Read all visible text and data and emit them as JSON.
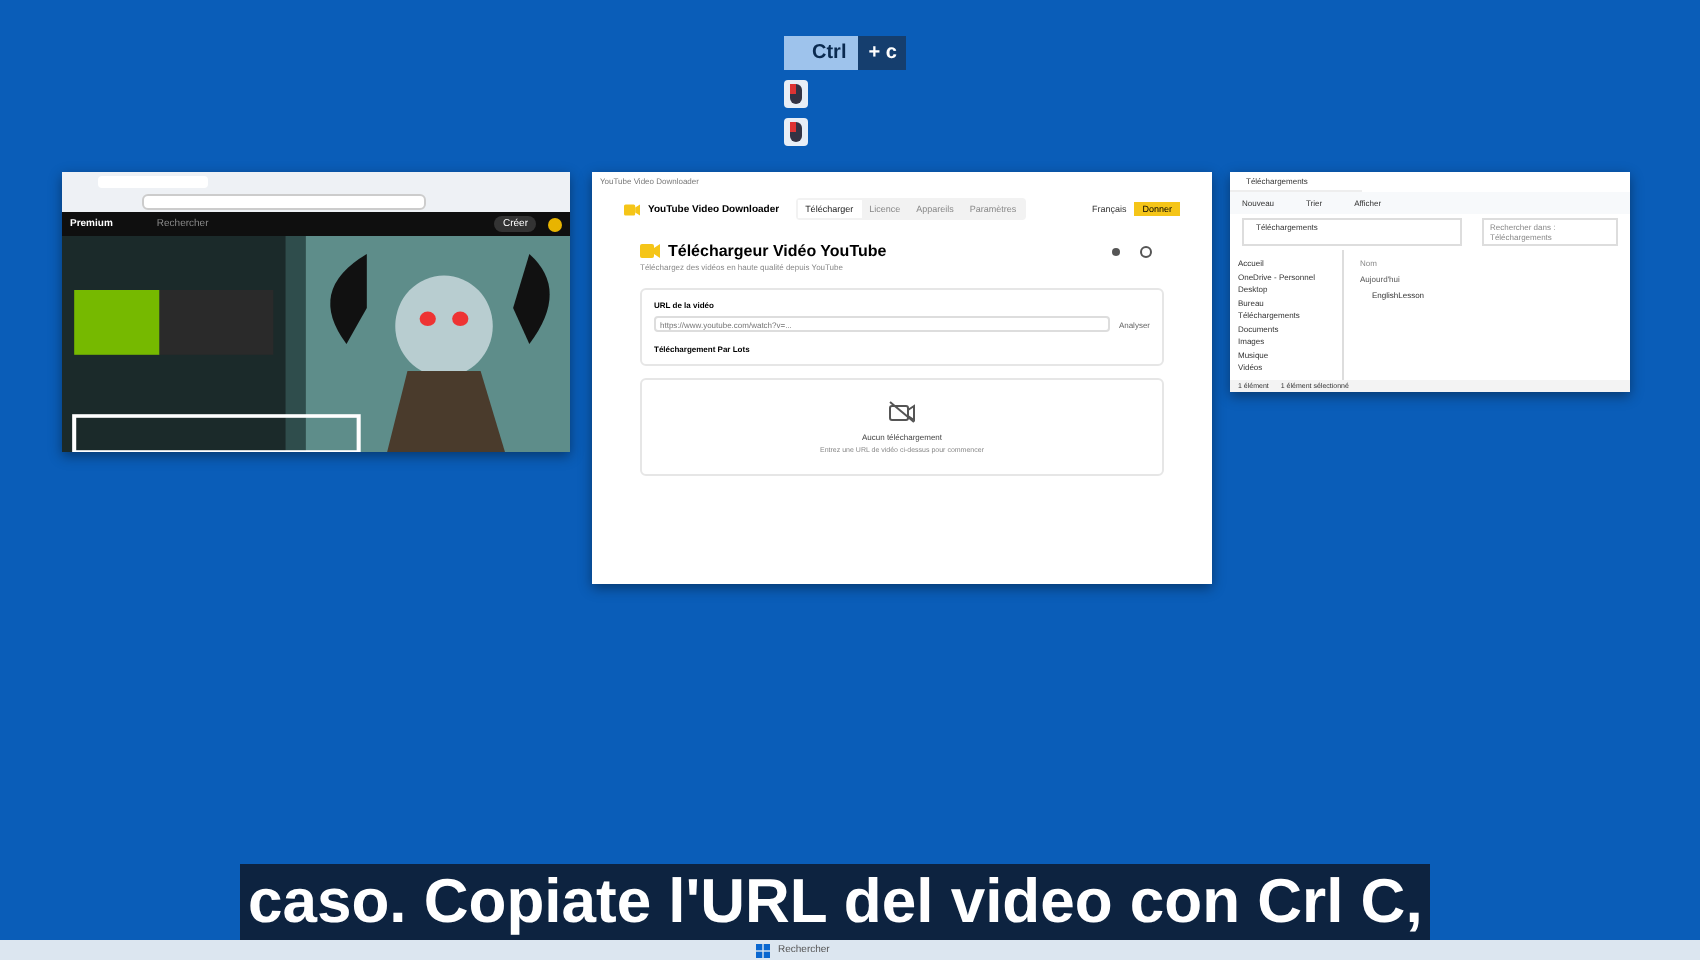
{
  "key_overlay": {
    "keys": [
      {
        "label": "Ctrl",
        "selected": true
      },
      {
        "label": "+ c",
        "selected": false
      }
    ],
    "clicks": [
      {
        "kind": "left"
      },
      {
        "kind": "left"
      }
    ]
  },
  "browser": {
    "logo": "Premium",
    "search": {
      "placeholder": "Rechercher"
    },
    "create_button": "Créer"
  },
  "downloader": {
    "title_bar": "YouTube Video Downloader",
    "app_name": "YouTube Video Downloader",
    "tabs": [
      {
        "label": "Télécharger",
        "selected": true
      },
      {
        "label": "Licence",
        "selected": false
      },
      {
        "label": "Appareils",
        "selected": false
      },
      {
        "label": "Paramètres",
        "selected": false
      }
    ],
    "language": "Français",
    "donate_button": "Donner",
    "heading": "Téléchargeur Vidéo YouTube",
    "subheading": "Téléchargez des vidéos en haute qualité depuis YouTube",
    "url_label": "URL de la vidéo",
    "url_placeholder": "https://www.youtube.com/watch?v=...",
    "analyze_button": "Analyser",
    "batch_button": "Téléchargement Par Lots",
    "empty_title": "Aucun téléchargement",
    "empty_hint": "Entrez une URL de vidéo ci-dessus pour commencer"
  },
  "explorer": {
    "tab": "Téléchargements",
    "toolbar": [
      "Nouveau",
      "Trier",
      "Afficher"
    ],
    "address": "Téléchargements",
    "search_placeholder": "Rechercher dans : Téléchargements",
    "sidebar": [
      "Accueil",
      "OneDrive - Personnel",
      "Desktop",
      "Bureau",
      "Téléchargements",
      "Documents",
      "Images",
      "Musique",
      "Vidéos"
    ],
    "column": "Nom",
    "group": "Aujourd'hui",
    "files": [
      "EnglishLesson"
    ],
    "status": [
      "1 élément",
      "1 élément sélectionné"
    ]
  },
  "subtitle": "caso. Copiate l'URL del video con Crl C,",
  "taskbar": {
    "search": "Rechercher"
  }
}
